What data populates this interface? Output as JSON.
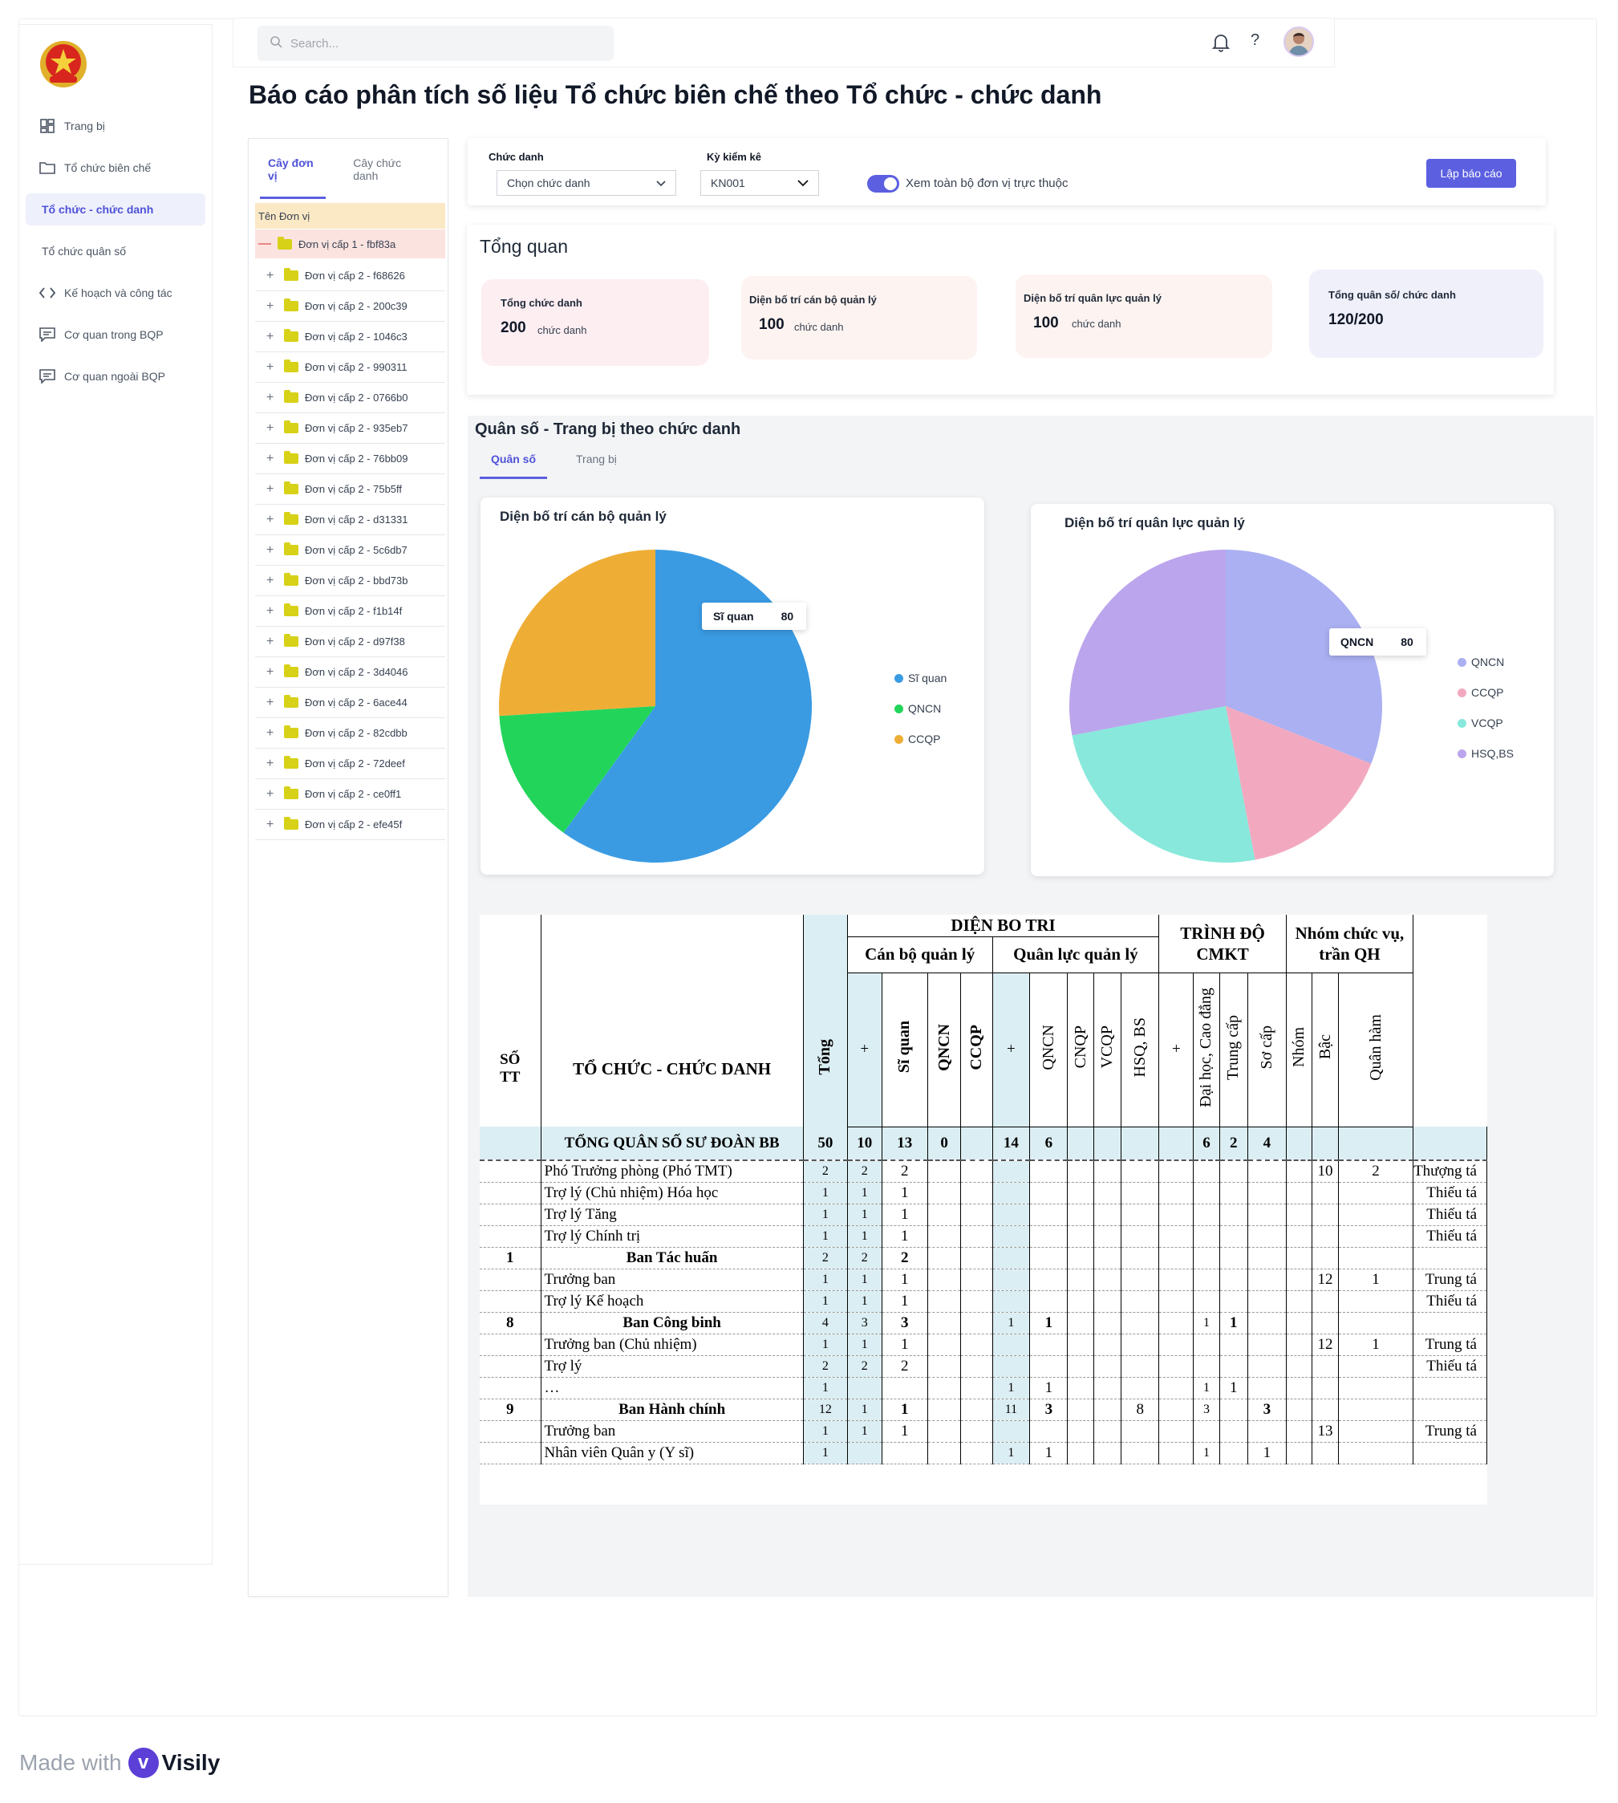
{
  "search": {
    "placeholder": "Search..."
  },
  "page_title": "Báo cáo phân tích số liệu Tổ chức biên chế theo Tổ chức - chức danh",
  "sidebar": {
    "items": [
      {
        "label": "Trang bị",
        "icon": "grid-icon"
      },
      {
        "label": "Tổ chức biên chế",
        "icon": "folder-icon"
      },
      {
        "label": "Tổ chức - chức danh",
        "icon": "",
        "active": true
      },
      {
        "label": "Tổ chức quân số",
        "icon": ""
      },
      {
        "label": "Kế hoạch và công tác",
        "icon": "code-icon"
      },
      {
        "label": "Cơ quan trong BQP",
        "icon": "message-icon"
      },
      {
        "label": "Cơ quan ngoài BQP",
        "icon": "message-icon"
      }
    ]
  },
  "tree": {
    "tabs": [
      "Cây đơn vị",
      "Cây chức danh"
    ],
    "header": "Tên Đơn vị",
    "root": "Đơn vị cấp 1 - fbf83a",
    "children": [
      "Đơn vị cấp 2 - f68626",
      "Đơn vị cấp 2 - 200c39",
      "Đơn vị cấp 2 - 1046c3",
      "Đơn vị cấp 2 - 990311",
      "Đơn vị cấp 2 - 0766b0",
      "Đơn vị cấp 2 - 935eb7",
      "Đơn vị cấp 2 - 76bb09",
      "Đơn vị cấp 2 - 75b5ff",
      "Đơn vị cấp 2 - d31331",
      "Đơn vị cấp 2 - 5c6db7",
      "Đơn vị cấp 2 - bbd73b",
      "Đơn vị cấp 2 - f1b14f",
      "Đơn vị cấp 2 - d97f38",
      "Đơn vị cấp 2 - 3d4046",
      "Đơn vị cấp 2 - 6ace44",
      "Đơn vị cấp 2 - 82cdbb",
      "Đơn vị cấp 2 - 72deef",
      "Đơn vị cấp 2 - ce0ff1",
      "Đơn vị cấp 2 - efe45f"
    ]
  },
  "filter": {
    "chuc_danh_label": "Chức danh",
    "chuc_danh_value": "Chọn chức danh",
    "ky_kiem_ke_label": "Kỳ kiểm kê",
    "ky_kiem_ke_value": "KN001",
    "toggle_label": "Xem toàn bộ đơn vị trực thuộc",
    "toggle_on": true,
    "button": "Lập báo cáo"
  },
  "overview": {
    "title": "Tổng quan",
    "cards": [
      {
        "title": "Tổng chức danh",
        "value": "200",
        "unit": "chức danh",
        "color": "#fdeef2"
      },
      {
        "title": "Diện bố trí cán bộ quản lý",
        "value": "100",
        "unit": "chức danh",
        "color": "#fdf3f0"
      },
      {
        "title": "Diện bố trí quân lực quản lý",
        "value": "100",
        "unit": "chức danh",
        "color": "#fdf3f0"
      },
      {
        "title": "Tổng quân số/ chức danh",
        "value": "120/200",
        "unit": "",
        "color": "#f0f0fb"
      }
    ]
  },
  "section": {
    "title": "Quân số - Trang bị theo chức danh",
    "tabs": [
      "Quân số",
      "Trang bị"
    ]
  },
  "chart_data": [
    {
      "type": "pie",
      "title": "Diện bố trí  cán bộ quản lý",
      "labels": [
        "Sĩ quan",
        "QNCN",
        "CCQP"
      ],
      "values": [
        60,
        14,
        26
      ],
      "colors": [
        "#3a9be3",
        "#22d55a",
        "#eeae36"
      ],
      "tooltip": {
        "label": "Sĩ quan",
        "value": "80"
      },
      "legend": "right"
    },
    {
      "type": "pie",
      "title": "Diện bố trí quân lực quản lý",
      "labels": [
        "QNCN",
        "CCQP",
        "VCQP",
        "HSQ,BS"
      ],
      "values": [
        31,
        16,
        25,
        28
      ],
      "colors": [
        "#aab0f2",
        "#f2a9bf",
        "#88e8dc",
        "#bba5ec"
      ],
      "tooltip": {
        "label": "QNCN",
        "value": "80"
      },
      "legend": "right"
    }
  ],
  "sheet": {
    "head": {
      "so_tt": "SỐ TT",
      "to_chuc": "TỔ CHỨC - CHỨC DANH",
      "tong": "Tổng",
      "dien_bo_tri": "DIỆN BO TRI",
      "can_bo": "Cán bộ quản lý",
      "quan_luc": "Quân lực quản lý",
      "trinh_do": "TRÌNH ĐỘ CMKT",
      "nhom_cv": "Nhóm chức vụ, trần QH",
      "plus": "+",
      "si_quan": "Sĩ quan",
      "qncn": "QNCN",
      "ccqp": "CCQP",
      "cnqp": "CNQP",
      "vcqp": "VCQP",
      "hsq": "HSQ, BS",
      "dai_hoc": "Đại học, Cao đẳng",
      "trung_cap": "Trung cấp",
      "so_cap": "Sơ cấp",
      "nhom": "Nhóm",
      "bac": "Bậc",
      "quan_ham": "Quân hàm"
    },
    "rows": [
      {
        "tt": "",
        "name": "TỔNG QUÂN SỐ SƯ ĐOÀN BB",
        "bold": true,
        "total": true,
        "c": [
          "50",
          "10",
          "13",
          "0",
          "",
          "14",
          "6",
          "",
          "",
          "",
          "",
          "6",
          "2",
          "4",
          "",
          "",
          "",
          ""
        ]
      },
      {
        "tt": "",
        "name": "Phó Trưởng phòng (Phó TMT)",
        "c": [
          "2",
          "2",
          "2",
          "",
          "",
          "",
          "",
          "",
          "",
          "",
          "",
          "",
          "",
          "",
          "",
          "10",
          "2",
          "Thượng tá"
        ]
      },
      {
        "tt": "",
        "name": "Trợ lý (Chủ nhiệm) Hóa học",
        "c": [
          "1",
          "1",
          "1",
          "",
          "",
          "",
          "",
          "",
          "",
          "",
          "",
          "",
          "",
          "",
          "",
          "",
          "",
          "Thiếu tá"
        ]
      },
      {
        "tt": "",
        "name": "Trợ lý Tăng",
        "c": [
          "1",
          "1",
          "1",
          "",
          "",
          "",
          "",
          "",
          "",
          "",
          "",
          "",
          "",
          "",
          "",
          "",
          "",
          "Thiếu tá"
        ]
      },
      {
        "tt": "",
        "name": "Trợ lý Chính trị",
        "c": [
          "1",
          "1",
          "1",
          "",
          "",
          "",
          "",
          "",
          "",
          "",
          "",
          "",
          "",
          "",
          "",
          "",
          "",
          "Thiếu tá"
        ]
      },
      {
        "tt": "1",
        "name": "Ban Tác huấn",
        "bold": true,
        "c": [
          "2",
          "2",
          "2",
          "",
          "",
          "",
          "",
          "",
          "",
          "",
          "",
          "",
          "",
          "",
          "",
          "",
          "",
          ""
        ]
      },
      {
        "tt": "",
        "name": "Trưởng ban",
        "c": [
          "1",
          "1",
          "1",
          "",
          "",
          "",
          "",
          "",
          "",
          "",
          "",
          "",
          "",
          "",
          "",
          "12",
          "1",
          "Trung tá"
        ]
      },
      {
        "tt": "",
        "name": "Trợ lý Kế hoạch",
        "c": [
          "1",
          "1",
          "1",
          "",
          "",
          "",
          "",
          "",
          "",
          "",
          "",
          "",
          "",
          "",
          "",
          "",
          "",
          "Thiếu tá"
        ]
      },
      {
        "tt": "8",
        "name": "Ban Công binh",
        "bold": true,
        "c": [
          "4",
          "3",
          "3",
          "",
          "",
          "1",
          "1",
          "",
          "",
          "",
          "",
          "1",
          "1",
          "",
          "",
          "",
          "",
          ""
        ]
      },
      {
        "tt": "",
        "name": "Trưởng ban (Chủ nhiệm)",
        "c": [
          "1",
          "1",
          "1",
          "",
          "",
          "",
          "",
          "",
          "",
          "",
          "",
          "",
          "",
          "",
          "",
          "12",
          "1",
          "Trung tá"
        ]
      },
      {
        "tt": "",
        "name": "Trợ lý",
        "c": [
          "2",
          "2",
          "2",
          "",
          "",
          "",
          "",
          "",
          "",
          "",
          "",
          "",
          "",
          "",
          "",
          "",
          "",
          "Thiếu tá"
        ]
      },
      {
        "tt": "",
        "name": "…",
        "c": [
          "1",
          "",
          "",
          "",
          "",
          "1",
          "1",
          "",
          "",
          "",
          "",
          "1",
          "1",
          "",
          "",
          "",
          "",
          ""
        ]
      },
      {
        "tt": "9",
        "name": "Ban Hành chính",
        "bold": true,
        "c": [
          "12",
          "1",
          "1",
          "",
          "",
          "11",
          "3",
          "",
          "",
          "8",
          "",
          "3",
          "",
          "3",
          "",
          "",
          "",
          ""
        ]
      },
      {
        "tt": "",
        "name": "Trưởng ban",
        "c": [
          "1",
          "1",
          "1",
          "",
          "",
          "",
          "",
          "",
          "",
          "",
          "",
          "",
          "",
          "",
          "",
          "13",
          "",
          "Trung tá"
        ]
      },
      {
        "tt": "",
        "name": "Nhân viên Quân y (Y sĩ)",
        "c": [
          "1",
          "",
          "",
          "",
          "",
          "1",
          "1",
          "",
          "",
          "",
          "",
          "1",
          "",
          "1",
          "",
          "",
          "",
          ""
        ]
      }
    ]
  },
  "footer": {
    "made_with": "Made with",
    "brand": "Visily"
  }
}
